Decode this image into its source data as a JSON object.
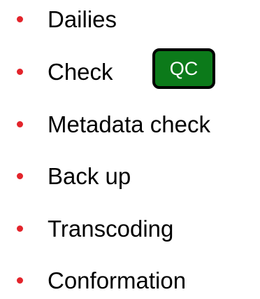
{
  "list": {
    "items": [
      {
        "label": "Dailies"
      },
      {
        "label": "Check",
        "badge": "QC"
      },
      {
        "label": "Metadata check"
      },
      {
        "label": "Back up"
      },
      {
        "label": "Transcoding"
      },
      {
        "label": "Conformation"
      }
    ]
  },
  "colors": {
    "bullet": "#e3242b",
    "badge_background": "#0c7a1a",
    "badge_border": "#000000",
    "badge_text": "#ffffff",
    "text": "#000000"
  }
}
